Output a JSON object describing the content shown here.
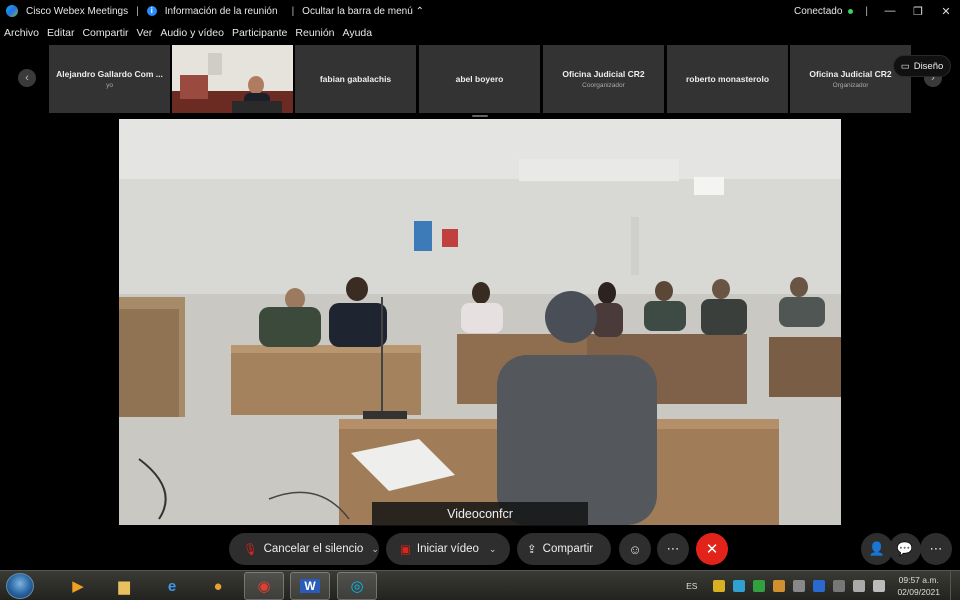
{
  "titlebar": {
    "app_title": "Cisco Webex Meetings",
    "sep1": "|",
    "meeting_info": "Información de la reunión",
    "sep2": "|",
    "hide_menu": "Ocultar la barra de menú",
    "hide_menu_icon": "chevron-up-icon",
    "status": "Conectado",
    "status_color": "#3ecf5d",
    "sep3": "|",
    "minimize": "—",
    "restore": "❐",
    "close": "✕"
  },
  "menu": {
    "items": [
      "Archivo",
      "Editar",
      "Compartir",
      "Ver",
      "Audio y vídeo",
      "Participante",
      "Reunión",
      "Ayuda"
    ]
  },
  "strip": {
    "prev_icon": "chevron-left-icon",
    "prev": "‹",
    "next": "›",
    "layout_button": "Diseño",
    "participants": [
      {
        "name": "Alejandro Gallardo Com ...",
        "role": "yo",
        "video": false
      },
      {
        "name": "",
        "role": "",
        "video": true
      },
      {
        "name": "fabian gabalachis",
        "role": "",
        "video": false
      },
      {
        "name": "abel boyero",
        "role": "",
        "video": false
      },
      {
        "name": "Oficina Judicial CR2",
        "role": "Coorganizador",
        "video": false
      },
      {
        "name": "roberto monasterolo",
        "role": "",
        "video": false
      },
      {
        "name": "Oficina Judicial CR2",
        "role": "Organizador",
        "video": false
      }
    ]
  },
  "main_video": {
    "label": "Videoconfcr"
  },
  "controls": {
    "mute_label": "Cancelar el silencio",
    "video_label": "Iniciar vídeo",
    "share_label": "Compartir",
    "mute_icon": "microphone-muted-icon",
    "video_icon": "video-off-icon",
    "share_icon": "share-icon",
    "reactions_icon": "smiley-icon",
    "more_icon": "more-icon",
    "end_icon": "close-icon",
    "participants_icon": "participants-icon",
    "chat_icon": "chat-icon",
    "end_color": "#e2231a",
    "more": "⋯",
    "end": "✕",
    "caret": "⌄"
  },
  "taskbar": {
    "apps": [
      "media-player-icon",
      "folder-icon",
      "ie-icon",
      "paint-icon",
      "chrome-icon",
      "word-icon",
      "webex-icon"
    ],
    "lang": "ES",
    "time": "09:57 a.m.",
    "date": "02/09/2021"
  }
}
